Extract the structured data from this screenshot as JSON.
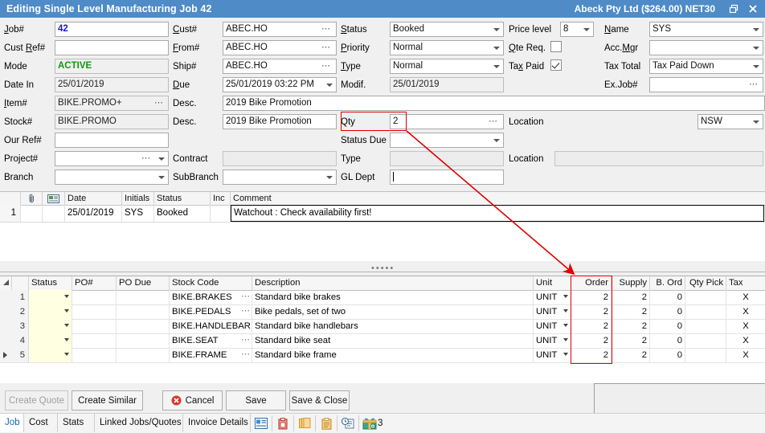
{
  "titlebar": {
    "title": "Editing Single Level Manufacturing Job 42",
    "customer": "Abeck Pty Ltd ($264.00) NET30",
    "restore_icon": "restore-window-icon",
    "close_icon": "close-icon"
  },
  "form": {
    "col1": [
      {
        "label": "Job#",
        "underline": "J",
        "value": "42",
        "style": "bold-blue"
      },
      {
        "label": "Cust Ref#",
        "underline": "R",
        "value": ""
      },
      {
        "label": "Mode",
        "value": "ACTIVE",
        "style": "bold-green"
      },
      {
        "label": "Date In",
        "value": "25/01/2019",
        "readonly": true
      },
      {
        "label": "Item#",
        "underline": "I",
        "value": "BIKE.PROMO+",
        "ellipsis": true,
        "readonly": true
      },
      {
        "label": "Stock#",
        "value": "BIKE.PROMO",
        "readonly": true
      },
      {
        "label": "Our Ref#",
        "value": ""
      },
      {
        "label": "Project#",
        "value": "",
        "ellipsis": true,
        "dropdown": true
      },
      {
        "label": "Branch",
        "value": "",
        "dropdown": true
      }
    ],
    "col2": [
      {
        "label": "Cust#",
        "underline": "C",
        "value": "ABEC.HO",
        "ellipsis": true
      },
      {
        "label": "From#",
        "underline": "F",
        "value": "ABEC.HO",
        "ellipsis": true
      },
      {
        "label": "Ship#",
        "value": "ABEC.HO",
        "ellipsis": true
      },
      {
        "label": "Due",
        "underline": "D",
        "value": "25/01/2019 03:22 PM",
        "dropdown": true
      },
      {
        "label": "Desc.",
        "value": "2019 Bike Promotion"
      },
      {
        "label": "Desc.",
        "value": "2019 Bike Promotion"
      },
      {
        "label": "",
        "value": ""
      },
      {
        "label": "Contract",
        "value": "",
        "readonly": true
      },
      {
        "label": "SubBranch",
        "value": "",
        "dropdown": true
      }
    ],
    "col3": [
      {
        "label": "Status",
        "underline": "S",
        "value": "Booked",
        "dropdown": true
      },
      {
        "label": "Priority",
        "underline": "P",
        "value": "Normal",
        "dropdown": true
      },
      {
        "label": "Type",
        "underline": "T",
        "value": "Normal",
        "dropdown": true
      },
      {
        "label": "Modif.",
        "value": "25/01/2019",
        "readonly": true
      },
      {
        "label": "Qty",
        "value": "2",
        "ellipsis": true,
        "highlight": true
      },
      {
        "label": "Status Due",
        "value": "",
        "dropdown": true
      },
      {
        "label": "Type",
        "value": "",
        "readonly": true
      },
      {
        "label": "GL Dept",
        "value": "",
        "caret": true
      }
    ],
    "col4": [
      {
        "label": "Price level",
        "value": "8",
        "dropdown": true
      },
      {
        "label": "Qte Req.",
        "underline": "Q",
        "checkbox": true,
        "checked": false
      },
      {
        "label": "Tax Paid",
        "underline": "x",
        "checkbox": true,
        "checked": true
      }
    ],
    "col5": [
      {
        "label": "Name",
        "underline": "N",
        "value": "SYS",
        "dropdown": true
      },
      {
        "label": "Acc.Mgr",
        "underline": "M",
        "value": "",
        "dropdown": true
      },
      {
        "label": "Tax Total",
        "value": "Tax Paid Down",
        "dropdown": true
      },
      {
        "label": "Ex.Job#",
        "value": "",
        "ellipsis": true
      }
    ],
    "location_rows": [
      {
        "label": "Location",
        "value": "NSW",
        "dropdown": true
      },
      {
        "label": "Location",
        "value": "",
        "readonly": true
      }
    ]
  },
  "comment_grid": {
    "headers": [
      "",
      "attachment-icon",
      "memo-icon",
      "Date",
      "Initials",
      "Status",
      "Inc",
      "Comment"
    ],
    "rows": [
      {
        "num": "1",
        "date": "25/01/2019",
        "initials": "SYS",
        "status": "Booked",
        "inc": false,
        "comment": "Watchout : Check availability first!"
      }
    ]
  },
  "main_grid": {
    "headers": [
      "Status",
      "PO#",
      "PO Due",
      "Stock Code",
      "Description",
      "Unit",
      "Order",
      "Supply",
      "B. Ord",
      "Qty Pick",
      "Tax"
    ],
    "rows": [
      {
        "num": "1",
        "status": "",
        "po": "",
        "po_due": "",
        "stock_code": "BIKE.BRAKES",
        "description": "Standard bike brakes",
        "unit": "UNIT",
        "order": "2",
        "supply": "2",
        "b_ord": "0",
        "qty_pick": "",
        "tax": "X",
        "supply_red": false,
        "current": false
      },
      {
        "num": "2",
        "status": "",
        "po": "",
        "po_due": "",
        "stock_code": "BIKE.PEDALS",
        "description": "Bike pedals, set of two",
        "unit": "UNIT",
        "order": "2",
        "supply": "2",
        "b_ord": "0",
        "qty_pick": "",
        "tax": "X",
        "supply_red": false,
        "current": false
      },
      {
        "num": "3",
        "status": "",
        "po": "",
        "po_due": "",
        "stock_code": "BIKE.HANDLEBAR",
        "description": "Standard bike handlebars",
        "unit": "UNIT",
        "order": "2",
        "supply": "2",
        "b_ord": "0",
        "qty_pick": "",
        "tax": "X",
        "supply_red": false,
        "current": false
      },
      {
        "num": "4",
        "status": "",
        "po": "",
        "po_due": "",
        "stock_code": "BIKE.SEAT",
        "description": "Standard bike seat",
        "unit": "UNIT",
        "order": "2",
        "supply": "2",
        "b_ord": "0",
        "qty_pick": "",
        "tax": "X",
        "supply_red": false,
        "current": false
      },
      {
        "num": "5",
        "status": "",
        "po": "",
        "po_due": "",
        "stock_code": "BIKE.FRAME",
        "description": "Standard bike frame",
        "unit": "UNIT",
        "order": "2",
        "supply": "2",
        "b_ord": "0",
        "qty_pick": "",
        "tax": "X",
        "supply_red": true,
        "current": true
      }
    ]
  },
  "buttons": [
    {
      "label": "Create Quote",
      "disabled": true
    },
    {
      "label": "Create Similar",
      "disabled": false
    },
    {
      "label": "Cancel",
      "disabled": false,
      "icon": "cancel-icon"
    },
    {
      "label": "Save",
      "disabled": false
    },
    {
      "label": "Save & Close",
      "disabled": false
    }
  ],
  "tabs": [
    {
      "label": "Job",
      "active": true
    },
    {
      "label": "Cost",
      "active": false
    },
    {
      "label": "Stats",
      "active": false
    },
    {
      "label": "Linked Jobs/Quotes",
      "active": false
    },
    {
      "label": "Invoice Details",
      "active": false
    }
  ],
  "tab_icons": [
    "card-icon",
    "paste-red-icon",
    "copy-icon",
    "clipboard-icon",
    "history-icon",
    "gift-money-icon"
  ],
  "tab_icon_count": "3",
  "annotation": {
    "color": "#e00000",
    "from": "Qty field",
    "to": "Order column"
  }
}
